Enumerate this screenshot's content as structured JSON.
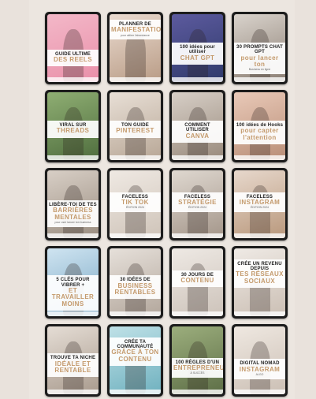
{
  "cards": [
    {
      "line1": "GUIDE ULTIME",
      "line2": "DES REELS",
      "line3": "",
      "photo": "woman-pink-bg",
      "bg1": "#f3b8c8",
      "bg2": "#e98fa9",
      "band_top": "52%"
    },
    {
      "line1": "PLANNER DE",
      "line2": "MANIFESTATION",
      "line3": "pour attirer l'abondance",
      "photo": "woman-curly-hair",
      "bg1": "#eadbd0",
      "bg2": "#b99c86",
      "band_top": "8%"
    },
    {
      "line1": "100 idées pour utiliser",
      "line2": "CHAT GPT",
      "line3": "",
      "photo": "woman-purple-bg",
      "bg1": "#5c5a9e",
      "bg2": "#2f3a6b",
      "band_top": "42%"
    },
    {
      "line1": "30 PROMPTS CHAT GPT",
      "line2": "pour lancer ton",
      "line3": "Business en ligne",
      "photo": "man-laptop",
      "bg1": "#d9d3cc",
      "bg2": "#8c7f74",
      "band_top": "42%"
    },
    {
      "line1": "VIRAL SUR",
      "line2": "THREADS",
      "line3": "",
      "photo": "woman-sun",
      "bg1": "#8fae73",
      "bg2": "#4f6e3e",
      "band_top": "42%"
    },
    {
      "line1": "TON GUIDE",
      "line2": "PINTEREST",
      "line3": "",
      "photo": "woman-smiling",
      "bg1": "#e8dfd6",
      "bg2": "#b8a796",
      "band_top": "42%"
    },
    {
      "line1": "COMMENT UTILISER",
      "line2": "CANVA",
      "line3": "",
      "photo": "woman-laptop",
      "bg1": "#d7cfc7",
      "bg2": "#998a7c",
      "band_top": "42%"
    },
    {
      "line1": "100 idées de Hooks",
      "line2": "pour capter l'attention",
      "line3": "",
      "photo": "woman-phone",
      "bg1": "#e9c9b8",
      "bg2": "#b98e77",
      "band_top": "42%"
    },
    {
      "line1": "LIBÈRE-TOI DE TES",
      "line2": "BARRIÈRES MENTALES",
      "line3": "pour oser lancer ton business",
      "photo": "woman-tattoo",
      "bg1": "#d8cfc6",
      "bg2": "#9a8d80",
      "band_top": "44%"
    },
    {
      "line1": "FACELESS",
      "line2": "TIK TOK",
      "line3": "ÉDITION 2024",
      "photo": "man-standing",
      "bg1": "#efe9e3",
      "bg2": "#cfc4b9",
      "band_top": "32%"
    },
    {
      "line1": "FACELESS",
      "line2": "STRATÉGIE",
      "line3": "ÉDITION 2024",
      "photo": "woman-sunglasses",
      "bg1": "#dfd8d0",
      "bg2": "#a4968a",
      "band_top": "32%"
    },
    {
      "line1": "FACELESS",
      "line2": "INSTAGRAM",
      "line3": "ÉDITION 2024",
      "photo": "woman-curly-smile",
      "bg1": "#e7d8cc",
      "bg2": "#b9987c",
      "band_top": "32%"
    },
    {
      "line1": "5 CLÉS POUR VIBRER +",
      "line2": "ET TRAVAILLER MOINS",
      "line3": "",
      "photo": "woman-relax",
      "bg1": "#cfe4f1",
      "bg2": "#7aa8c4",
      "band_top": "40%"
    },
    {
      "line1": "30 IDÉES DE",
      "line2": "BUSINESS RENTABLES",
      "line3": "",
      "photo": "office-desk",
      "bg1": "#e6e0da",
      "bg2": "#b3a79c",
      "band_top": "40%"
    },
    {
      "line1": "30 JOURS DE",
      "line2": "CONTENU",
      "line3": "",
      "photo": "laptop-flatlay",
      "bg1": "#eee9e4",
      "bg2": "#cdc3ba",
      "band_top": "32%"
    },
    {
      "line1": "CRÉE UN REVENU DEPUIS",
      "line2": "TES RÉSEAUX SOCIAUX",
      "line3": "",
      "photo": "flatlay-notebook",
      "bg1": "#efeae5",
      "bg2": "#cbbfb4",
      "band_top": "16%"
    },
    {
      "line1": "TROUVE TA NICHE",
      "line2": "IDÉALE ET RENTABLE",
      "line3": "",
      "photo": "woman-coffee",
      "bg1": "#e5ddd5",
      "bg2": "#a89a8d",
      "band_top": "40%"
    },
    {
      "line1": "CRÉE TA COMMUNAUTÉ",
      "line2": "GRÂCE À TON CONTENU",
      "line3": "",
      "photo": "woman-pool",
      "bg1": "#bfe1e7",
      "bg2": "#6fb1bf",
      "band_top": "16%"
    },
    {
      "line1": "100 RÈGLES D'UN",
      "line2": "ENTREPRENEUR",
      "line3": "À SUCCÈS",
      "photo": "woman-green",
      "bg1": "#9cae7d",
      "bg2": "#5d6e46",
      "band_top": "46%"
    },
    {
      "line1": "DIGITAL NOMAD",
      "line2": "INSTAGRAM",
      "line3": "ALGO",
      "photo": "phone-hand",
      "bg1": "#efe8e1",
      "bg2": "#cbbfb4",
      "band_top": "48%"
    }
  ]
}
